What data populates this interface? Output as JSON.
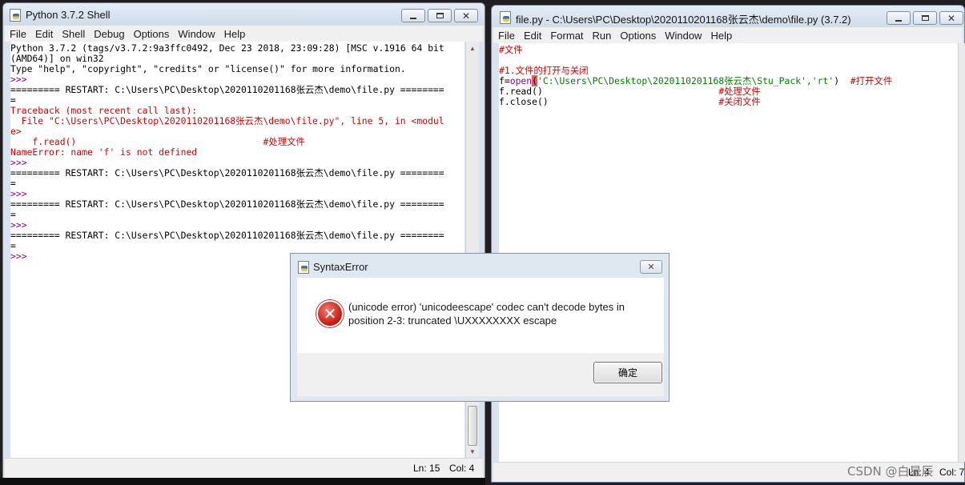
{
  "shell_window": {
    "title": "Python 3.7.2 Shell",
    "menu": [
      "File",
      "Edit",
      "Shell",
      "Debug",
      "Options",
      "Window",
      "Help"
    ],
    "lines": [
      {
        "text": "Python 3.7.2 (tags/v3.7.2:9a3ffc0492, Dec 23 2018, 23:09:28) [MSC v.1916 64 bit",
        "color": "#000000"
      },
      {
        "text": "(AMD64)] on win32",
        "color": "#000000"
      },
      {
        "text": "Type \"help\", \"copyright\", \"credits\" or \"license()\" for more information.",
        "color": "#000000"
      },
      {
        "text": ">>> ",
        "color": "#900090"
      },
      {
        "text": "========= RESTART: C:\\Users\\PC\\Desktop\\2020110201168张云杰\\demo\\file.py ========",
        "color": "#000000"
      },
      {
        "text": "=",
        "color": "#000000"
      },
      {
        "text": "Traceback (most recent call last):",
        "color": "#dd0000"
      },
      {
        "text": "  File \"C:\\Users\\PC\\Desktop\\2020110201168张云杰\\demo\\file.py\", line 5, in <modul",
        "color": "#dd0000"
      },
      {
        "text": "e>",
        "color": "#dd0000"
      },
      {
        "text": "    f.read()                                  #处理文件",
        "color": "#dd0000"
      },
      {
        "text": "NameError: name 'f' is not defined",
        "color": "#dd0000"
      },
      {
        "text": ">>> ",
        "color": "#900090"
      },
      {
        "text": "========= RESTART: C:\\Users\\PC\\Desktop\\2020110201168张云杰\\demo\\file.py ========",
        "color": "#000000"
      },
      {
        "text": "=",
        "color": "#000000"
      },
      {
        "text": ">>> ",
        "color": "#900090"
      },
      {
        "text": "========= RESTART: C:\\Users\\PC\\Desktop\\2020110201168张云杰\\demo\\file.py ========",
        "color": "#000000"
      },
      {
        "text": "=",
        "color": "#000000"
      },
      {
        "text": ">>> ",
        "color": "#900090"
      },
      {
        "text": "========= RESTART: C:\\Users\\PC\\Desktop\\2020110201168张云杰\\demo\\file.py ========",
        "color": "#000000"
      },
      {
        "text": "=",
        "color": "#000000"
      },
      {
        "text": ">>> ",
        "color": "#900090"
      }
    ],
    "status": {
      "ln": "Ln: 15",
      "col": "Col: 4"
    }
  },
  "editor_window": {
    "title": "file.py - C:\\Users\\PC\\Desktop\\2020110201168张云杰\\demo\\file.py (3.7.2)",
    "menu": [
      "File",
      "Edit",
      "Format",
      "Run",
      "Options",
      "Window",
      "Help"
    ],
    "code": {
      "line1": "#文件",
      "line2": "",
      "line3": "#1.文件的打开与关闭",
      "line4": {
        "pre": "f=",
        "builtin": "open",
        "paren": "(",
        "string": "'C:\\Users\\PC\\Desktop\\2020110201168张云杰\\Stu_Pack','rt'",
        "close": ")  ",
        "comment": "#打开文件"
      },
      "line5": {
        "code": "f.read()                                ",
        "comment": "#处理文件"
      },
      "line6": {
        "code": "f.close()                               ",
        "comment": "#关闭文件"
      }
    },
    "status": {
      "ln": "Ln: 4",
      "col": "Col: 7"
    }
  },
  "dialog": {
    "title": "SyntaxError",
    "message": "(unicode error) 'unicodeescape' codec can't decode bytes in position 2-3: truncated \\UXXXXXXXX escape",
    "ok_label": "确定",
    "close_glyph": "✕",
    "error_glyph": "✕"
  },
  "watermark": "CSDN @白星辰",
  "glyphs": {
    "close": "✕",
    "arrow_up": "▲",
    "arrow_down": "▼"
  },
  "colors": {
    "keyword_builtin": "#900090",
    "string": "#008000",
    "comment": "#dd0000",
    "error_text": "#dd0000"
  }
}
